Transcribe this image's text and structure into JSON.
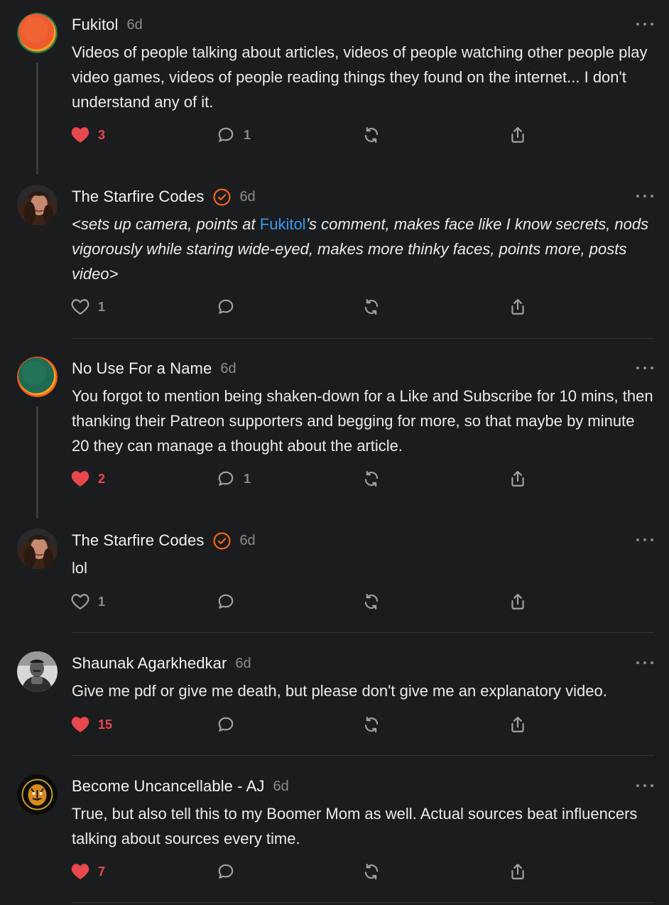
{
  "colors": {
    "background": "#1b1c1e",
    "accent_like": "#e8484e",
    "verified": "#ff6719",
    "mention": "#3a97f0"
  },
  "comments": [
    {
      "name": "Fukitol",
      "time": "6d",
      "verified": false,
      "avatar": "gradient-orange",
      "text": "Videos of people talking about articles, videos of people watching other people play video games, videos of people reading things they found on the internet... I don't understand any of it.",
      "likes": "3",
      "liked": true,
      "replies": "1"
    },
    {
      "name": "The Starfire Codes",
      "time": "6d",
      "verified": true,
      "avatar": "photo-woman",
      "text_before": "<sets up camera, points at ",
      "mention": "Fukitol",
      "text_after": "’s comment, makes face like I know secrets, nods vigorously while staring wide-eyed, makes more thinky faces, points more, posts video>",
      "likes": "1",
      "liked": false,
      "replies": ""
    },
    {
      "name": "No Use For a Name",
      "time": "6d",
      "verified": false,
      "avatar": "gradient-green",
      "text": "You forgot to mention being shaken-down for a Like and Subscribe for 10 mins, then thanking their Patreon supporters and begging for more, so that maybe by minute 20 they can manage a thought about the article.",
      "likes": "2",
      "liked": true,
      "replies": "1"
    },
    {
      "name": "The Starfire Codes",
      "time": "6d",
      "verified": true,
      "avatar": "photo-woman",
      "text": "lol",
      "likes": "1",
      "liked": false,
      "replies": ""
    },
    {
      "name": "Shaunak Agarkhedkar",
      "time": "6d",
      "verified": false,
      "avatar": "photo-man-bw",
      "text": "Give me pdf or give me death, but please don't give me an explanatory video.",
      "likes": "15",
      "liked": true,
      "replies": ""
    },
    {
      "name": "Become Uncancellable - AJ",
      "time": "6d",
      "verified": false,
      "avatar": "tiger-logo",
      "text": "True, but also tell this to my Boomer Mom as well. Actual sources beat influencers talking about sources every time.",
      "likes": "7",
      "liked": true,
      "replies": ""
    }
  ],
  "icons": [
    "heart-icon",
    "comment-icon",
    "restack-icon",
    "share-icon",
    "more-icon",
    "verified-icon"
  ]
}
